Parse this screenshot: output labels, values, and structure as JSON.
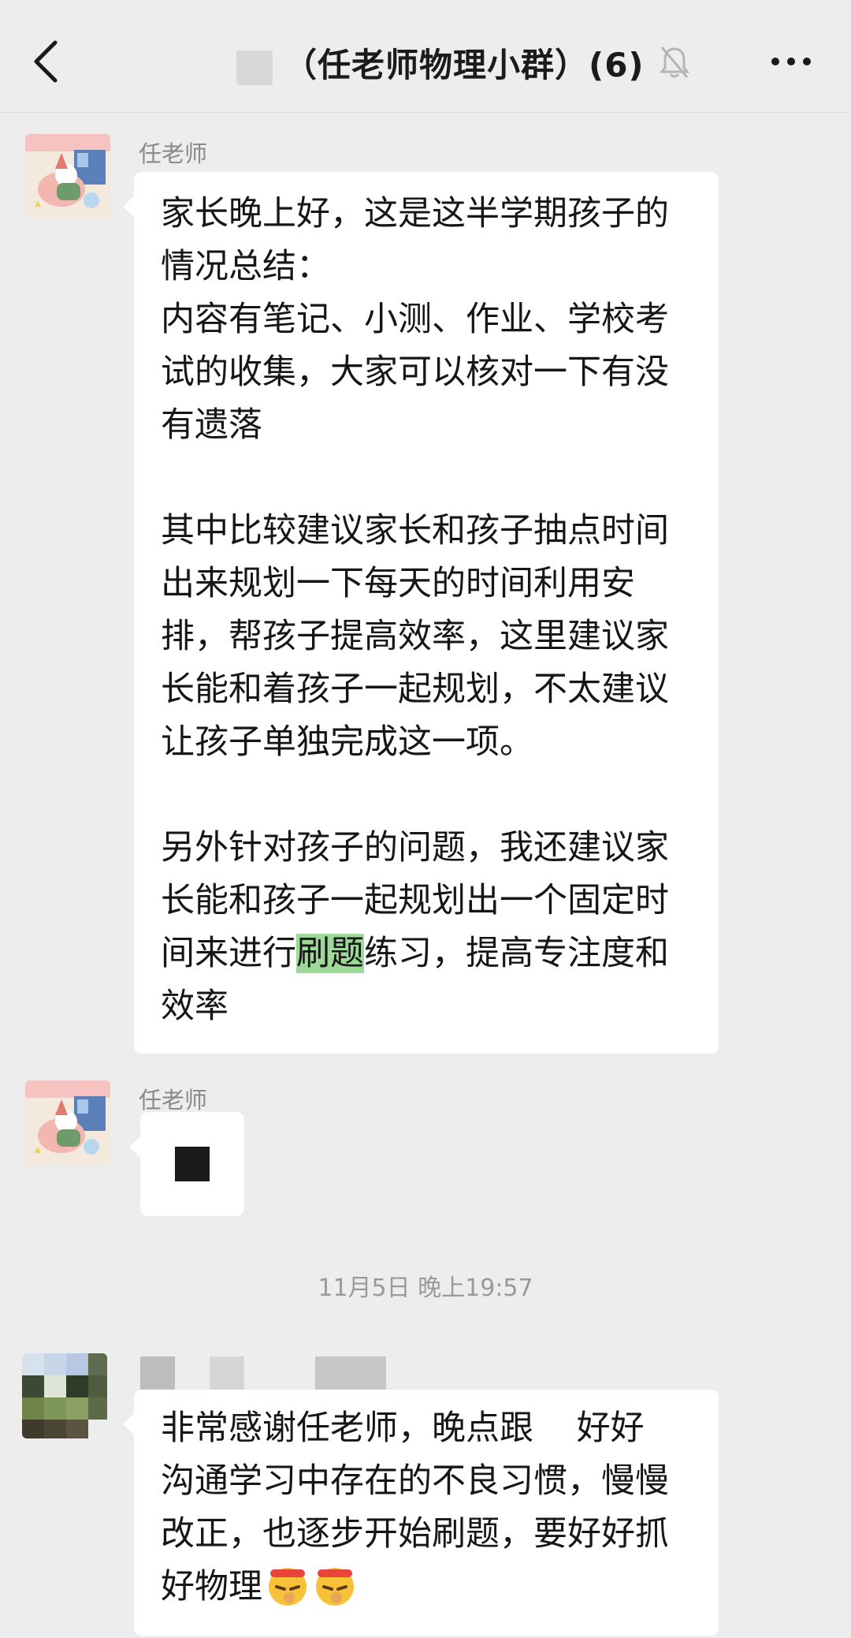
{
  "header": {
    "title": "（任老师物理小群）(6)",
    "back_icon": "chevron-left-icon",
    "mute_icon": "bell-off-icon",
    "more_icon": "ellipsis-icon"
  },
  "messages": [
    {
      "sender": "任老师",
      "text_a": "家长晚上好，这是这半学期孩子的\n情况总结：\n内容有笔记、小测、作业、学校考\n试的收集，大家可以核对一下有没\n有遗落\n\n其中比较建议家长和孩子抽点时间\n出来规划一下每天的时间利用安\n排，帮孩子提高效率，这里建议家\n长能和着孩子一起规划，不太建议\n让孩子单独完成这一项。\n\n另外针对孩子的问题，我还建议家\n长能和孩子一起规划出一个固定时\n间来进行",
      "highlight": "刷题",
      "text_b": "练习，提高专注度和\n效率"
    },
    {
      "sender": "任老师",
      "attachment_icon": "file-icon"
    }
  ],
  "timestamp": "11月5日 晚上19:57",
  "reply": {
    "text": "非常感谢任老师，晚点跟    好好\n沟通学习中存在的不良习惯，慢慢\n改正，也逐步开始刷题，要好好抓\n好物理",
    "emoji": "determined-face-emoji",
    "emoji_count": 2
  },
  "colors": {
    "background": "#ededed",
    "bubble": "#ffffff",
    "highlight": "#9fd99a"
  }
}
